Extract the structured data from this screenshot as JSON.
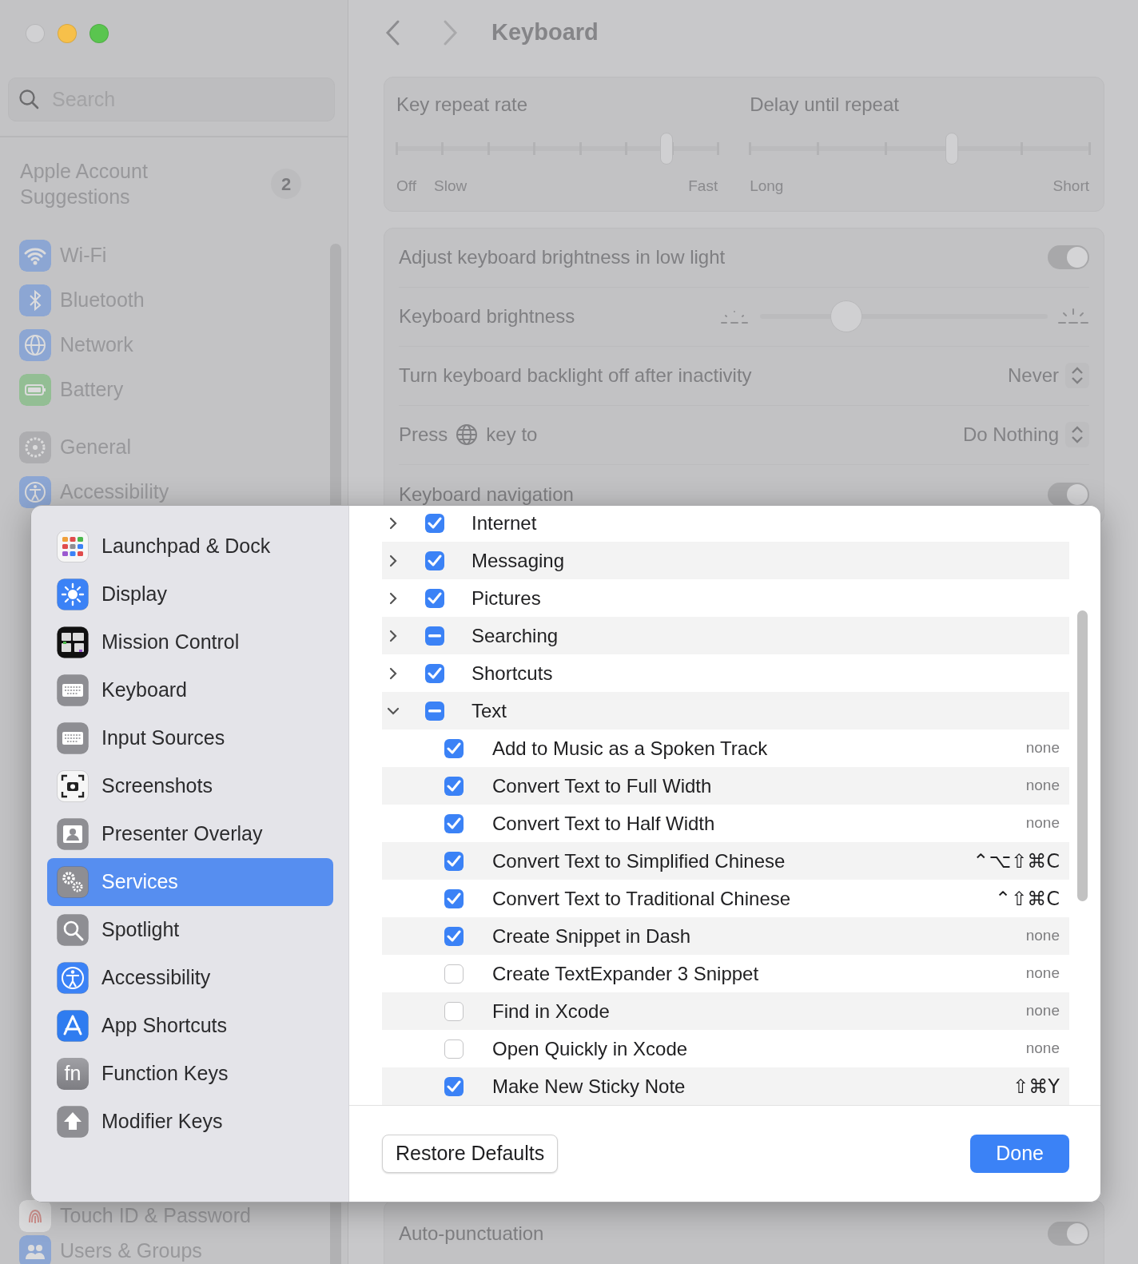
{
  "sidebar": {
    "search": {
      "placeholder": "Search"
    },
    "account": {
      "label": "Apple Account Suggestions",
      "badge": "2"
    },
    "groups": [
      {
        "items": [
          {
            "label": "Wi-Fi"
          },
          {
            "label": "Bluetooth"
          },
          {
            "label": "Network"
          },
          {
            "label": "Battery"
          }
        ]
      },
      {
        "items": [
          {
            "label": "General"
          },
          {
            "label": "Accessibility"
          }
        ]
      }
    ],
    "bottom_items": [
      {
        "label": "Touch ID & Password"
      },
      {
        "label": "Users & Groups"
      }
    ]
  },
  "header": {
    "title": "Keyboard"
  },
  "sliders": [
    {
      "label": "Key repeat rate",
      "level": 0.84,
      "labels": [
        "Off",
        "Slow",
        "Fast"
      ]
    },
    {
      "label": "Delay until repeat",
      "level": 0.595,
      "labels": [
        "Long",
        "Short"
      ]
    }
  ],
  "settings": [
    {
      "kind": "toggle",
      "label": "Adjust keyboard brightness in low light",
      "on": true
    },
    {
      "kind": "slider",
      "label": "Keyboard brightness",
      "level": 0.3
    },
    {
      "kind": "popup",
      "label": "Turn keyboard backlight off after inactivity",
      "value": "Never"
    },
    {
      "kind": "popup",
      "label": "Press",
      "label_after": "key to",
      "value": "Do Nothing"
    },
    {
      "kind": "toggle",
      "label": "Keyboard navigation",
      "on": true
    }
  ],
  "settings_bottom": [
    {
      "kind": "toggle",
      "label": "Auto-punctuation",
      "on": true
    }
  ],
  "sheet": {
    "sidebar": [
      {
        "label": "Launchpad & Dock",
        "selected": false
      },
      {
        "label": "Display",
        "selected": false
      },
      {
        "label": "Mission Control",
        "selected": false
      },
      {
        "label": "Keyboard",
        "selected": false
      },
      {
        "label": "Input Sources",
        "selected": false
      },
      {
        "label": "Screenshots",
        "selected": false
      },
      {
        "label": "Presenter Overlay",
        "selected": false
      },
      {
        "label": "Services",
        "selected": true
      },
      {
        "label": "Spotlight",
        "selected": false
      },
      {
        "label": "Accessibility",
        "selected": false
      },
      {
        "label": "App Shortcuts",
        "selected": false
      },
      {
        "label": "Function Keys",
        "icon_text": "fn",
        "selected": false
      },
      {
        "label": "Modifier Keys",
        "selected": false
      }
    ],
    "services": [
      {
        "label": "Internet",
        "checked": true,
        "mixed": false,
        "expanded": false
      },
      {
        "label": "Messaging",
        "checked": true,
        "mixed": false,
        "expanded": false
      },
      {
        "label": "Pictures",
        "checked": true,
        "mixed": false,
        "expanded": false
      },
      {
        "label": "Searching",
        "checked": false,
        "mixed": true,
        "expanded": false
      },
      {
        "label": "Shortcuts",
        "checked": true,
        "mixed": false,
        "expanded": false
      },
      {
        "label": "Text",
        "checked": false,
        "mixed": true,
        "expanded": true,
        "children": [
          {
            "label": "Add to Music as a Spoken Track",
            "checked": true,
            "shortcut": {
              "text": "none",
              "kind": "unassigned"
            }
          },
          {
            "label": "Convert Text to Full Width",
            "checked": true,
            "shortcut": {
              "text": "none",
              "kind": "unassigned"
            }
          },
          {
            "label": "Convert Text to Half Width",
            "checked": true,
            "shortcut": {
              "text": "none",
              "kind": "unassigned"
            }
          },
          {
            "label": "Convert Text to Simplified Chinese",
            "checked": true,
            "shortcut": {
              "text": "⌃⌥⇧⌘C",
              "kind": "keys"
            }
          },
          {
            "label": "Convert Text to Traditional Chinese",
            "checked": true,
            "shortcut": {
              "text": "⌃⇧⌘C",
              "kind": "keys"
            }
          },
          {
            "label": "Create Snippet in Dash",
            "checked": true,
            "shortcut": {
              "text": "none",
              "kind": "unassigned"
            }
          },
          {
            "label": "Create TextExpander 3 Snippet",
            "checked": false,
            "shortcut": {
              "text": "none",
              "kind": "unassigned"
            }
          },
          {
            "label": "Find in Xcode",
            "checked": false,
            "shortcut": {
              "text": "none",
              "kind": "unassigned"
            }
          },
          {
            "label": "Open Quickly in Xcode",
            "checked": false,
            "shortcut": {
              "text": "none",
              "kind": "unassigned"
            }
          },
          {
            "label": "Make New Sticky Note",
            "checked": true,
            "shortcut": {
              "text": "⇧⌘Y",
              "kind": "keys"
            }
          }
        ]
      }
    ],
    "buttons": [
      {
        "label": "Restore Defaults",
        "kind": "secondary"
      },
      {
        "label": "Done",
        "kind": "primary"
      }
    ]
  }
}
